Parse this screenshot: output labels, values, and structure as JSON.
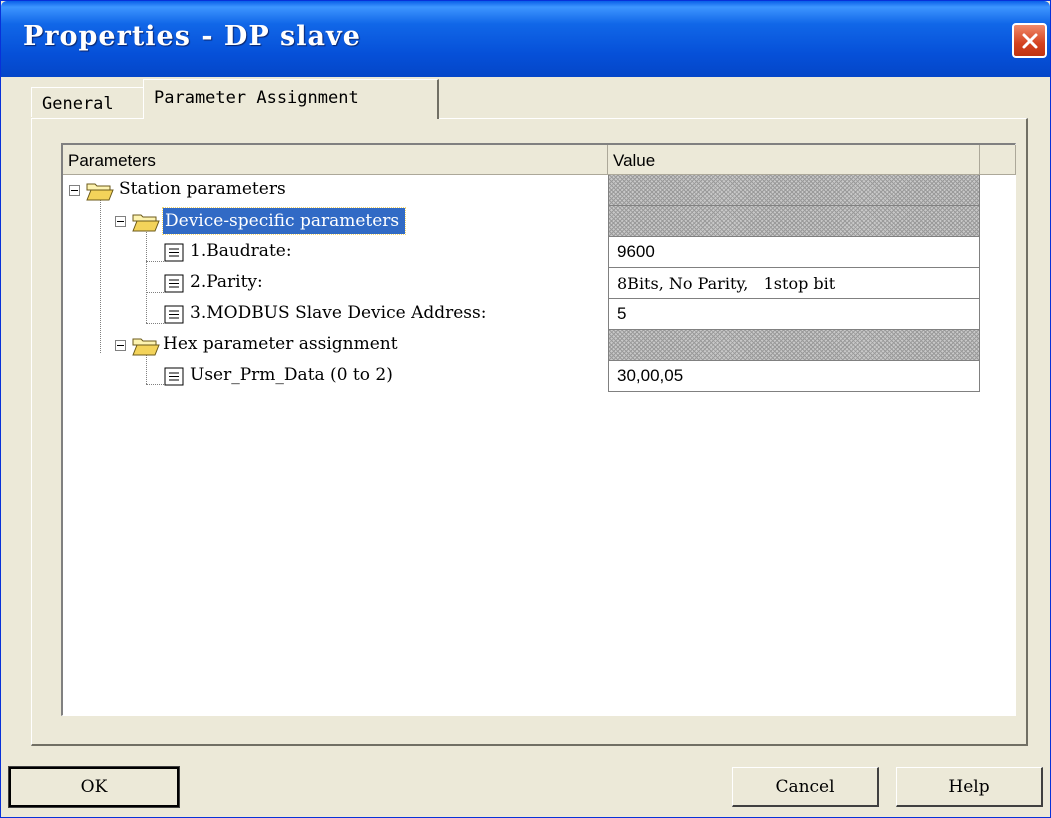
{
  "window": {
    "title": "Properties - DP slave"
  },
  "tabs": [
    {
      "label": "General",
      "active": false
    },
    {
      "label": "Parameter Assignment",
      "active": true
    }
  ],
  "grid": {
    "columns": [
      "Parameters",
      "Value"
    ],
    "rows": [
      {
        "label": "Station parameters",
        "value": "",
        "type": "folder",
        "level": 0
      },
      {
        "label": "Device-specific parameters",
        "value": "",
        "type": "folder",
        "level": 1,
        "selected": true
      },
      {
        "label": "1.Baudrate:",
        "value": "9600",
        "type": "item",
        "level": 2
      },
      {
        "label": "2.Parity:",
        "value": "8Bits, No Parity,   1stop bit",
        "type": "item",
        "level": 2
      },
      {
        "label": "3.MODBUS Slave Device Address:",
        "value": "5",
        "type": "item",
        "level": 2
      },
      {
        "label": "Hex parameter assignment",
        "value": "",
        "type": "folder",
        "level": 1
      },
      {
        "label": "User_Prm_Data (0 to 2)",
        "value": "30,00,05",
        "type": "item",
        "level": 2
      }
    ]
  },
  "buttons": {
    "ok": "OK",
    "cancel": "Cancel",
    "help": "Help"
  },
  "colors": {
    "title_bar": "#0650d8",
    "selection": "#316ac5",
    "face": "#ece9d8",
    "close_button": "#d4421f"
  }
}
